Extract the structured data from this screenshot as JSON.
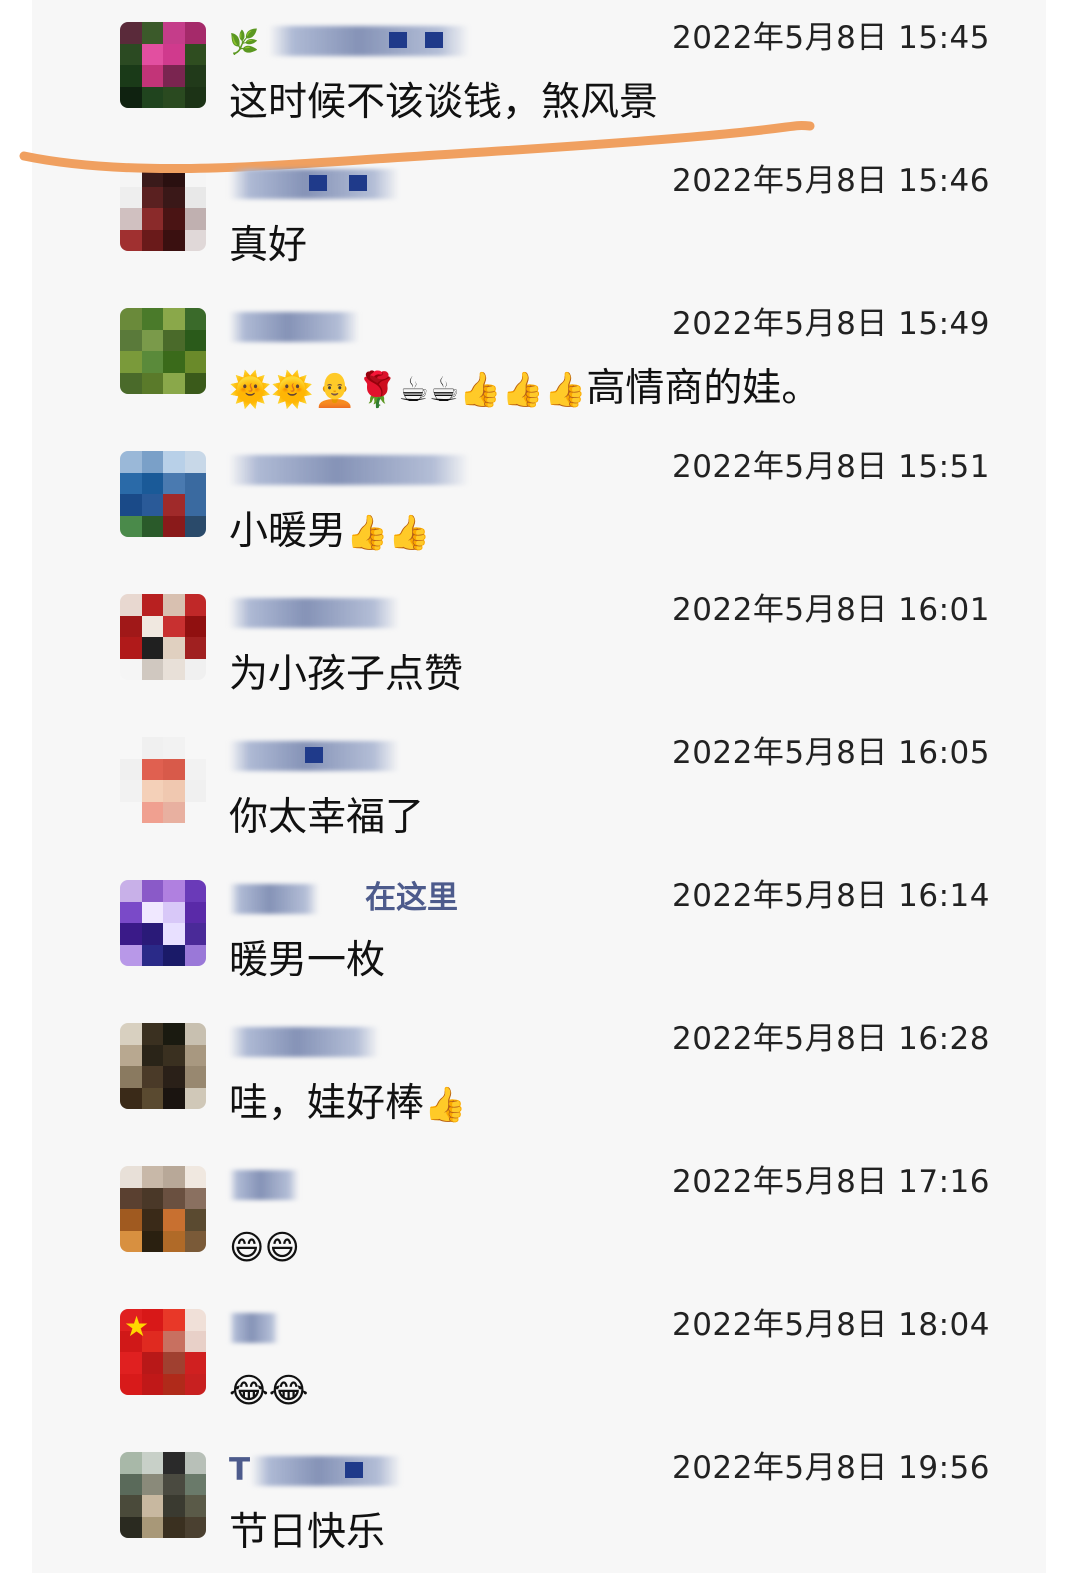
{
  "comments": [
    {
      "avatar": "rose-photo-avatar",
      "nickname_prefix_icon": "🌿",
      "nickname": "",
      "timestamp": "2022年5月8日 15:45",
      "message": "这时候不该谈钱，煞风景"
    },
    {
      "avatar": "woman-photo-avatar",
      "nickname": "",
      "timestamp": "2022年5月8日 15:46",
      "message": "真好"
    },
    {
      "avatar": "green-plant-avatar",
      "nickname": "",
      "timestamp": "2022年5月8日 15:49",
      "message_emojis": "🌞🌞🧑‍🦲🌹☕☕👍👍👍",
      "message": "高情商的娃。"
    },
    {
      "avatar": "lake-photo-avatar",
      "nickname": "",
      "timestamp": "2022年5月8日 15:51",
      "message": "小暖男",
      "message_emojis": "👍👍"
    },
    {
      "avatar": "red-scene-avatar",
      "nickname": "",
      "timestamp": "2022年5月8日 16:01",
      "message": "为小孩子点赞"
    },
    {
      "avatar": "cartoon-girl-avatar",
      "nickname": "",
      "timestamp": "2022年5月8日 16:05",
      "message": "你太幸福了"
    },
    {
      "avatar": "purple-star-avatar",
      "nickname": "在这里",
      "timestamp": "2022年5月8日 16:14",
      "message": "暖男一枚"
    },
    {
      "avatar": "dark-figure-avatar",
      "nickname": "",
      "timestamp": "2022年5月8日 16:28",
      "message": "哇，娃好棒",
      "message_emojis": "👍"
    },
    {
      "avatar": "autumn-photo-avatar",
      "nickname": "",
      "timestamp": "2022年5月8日 17:16",
      "message_emojis": "😄😄",
      "message": ""
    },
    {
      "avatar": "red-flag-avatar",
      "nickname": "",
      "timestamp": "2022年5月8日 18:04",
      "message_emojis": "😂😂",
      "message": ""
    },
    {
      "avatar": "beach-photo-avatar",
      "nickname": "T",
      "timestamp": "2022年5月8日 19:56",
      "message": "节日快乐"
    }
  ],
  "colors": {
    "panel_bg": "#f7f7f7",
    "nickname": "#4d5b8c",
    "timestamp": "#222222",
    "message": "#111111",
    "highlight_stroke": "#f0a060"
  }
}
